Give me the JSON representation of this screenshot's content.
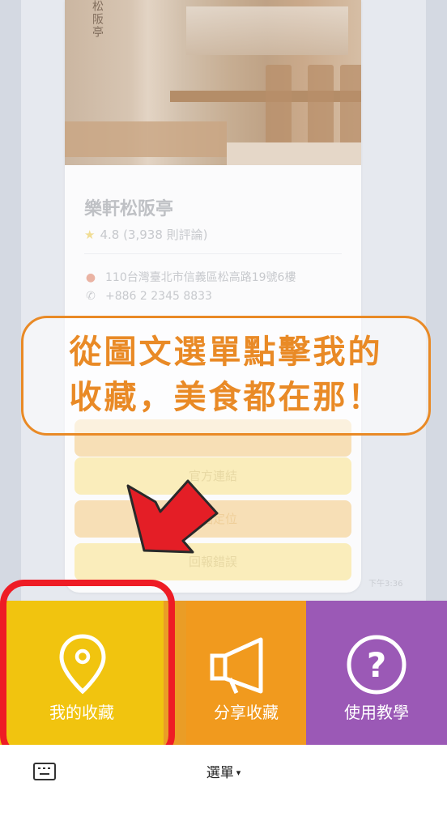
{
  "restaurant": {
    "name": "樂軒松阪亭",
    "rating": "4.8 (3,938 則評論)",
    "address": "110台灣臺北市信義區松高路19號6樓",
    "phone": "+886 2 2345 8833",
    "sign_text": "松阪亭"
  },
  "card_buttons": [
    "官方連結",
    "地圖定位",
    "回報錯誤"
  ],
  "timestamp": "下午3:36",
  "callout": {
    "line1": "從圖文選單點擊我的",
    "line2": "收藏，美食都在那！"
  },
  "rich_menu": {
    "items": [
      {
        "label": "我的收藏",
        "icon": "map-pin-icon",
        "color": "#f1c40f"
      },
      {
        "label": "分享收藏",
        "icon": "megaphone-icon",
        "color": "#f19a1e"
      },
      {
        "label": "使用教學",
        "icon": "question-icon",
        "color": "#9b59b6"
      }
    ]
  },
  "bottom_bar": {
    "menu_label": "選單",
    "caret": "▾"
  },
  "colors": {
    "callout_orange": "#e98a26",
    "highlight_red": "#ee1c25",
    "arrow_red": "#e41e26"
  }
}
